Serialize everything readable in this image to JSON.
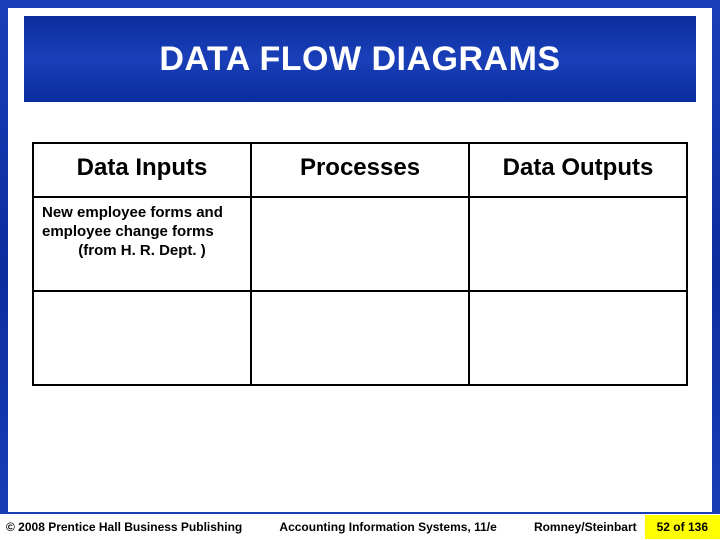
{
  "title": "DATA FLOW DIAGRAMS",
  "table": {
    "headers": [
      "Data Inputs",
      "Processes",
      "Data Outputs"
    ],
    "rows": [
      [
        {
          "line1": "New employee forms and",
          "line2": "employee change forms",
          "line3": "(from H. R. Dept. )"
        },
        {
          "line1": "",
          "line2": "",
          "line3": ""
        },
        {
          "line1": "",
          "line2": "",
          "line3": ""
        }
      ],
      [
        {
          "line1": "",
          "line2": "",
          "line3": ""
        },
        {
          "line1": "",
          "line2": "",
          "line3": ""
        },
        {
          "line1": "",
          "line2": "",
          "line3": ""
        }
      ]
    ]
  },
  "footer": {
    "copyright": "© 2008 Prentice Hall Business Publishing",
    "center": "Accounting Information Systems, 11/e",
    "authors": "Romney/Steinbart",
    "page": "52 of 136"
  }
}
